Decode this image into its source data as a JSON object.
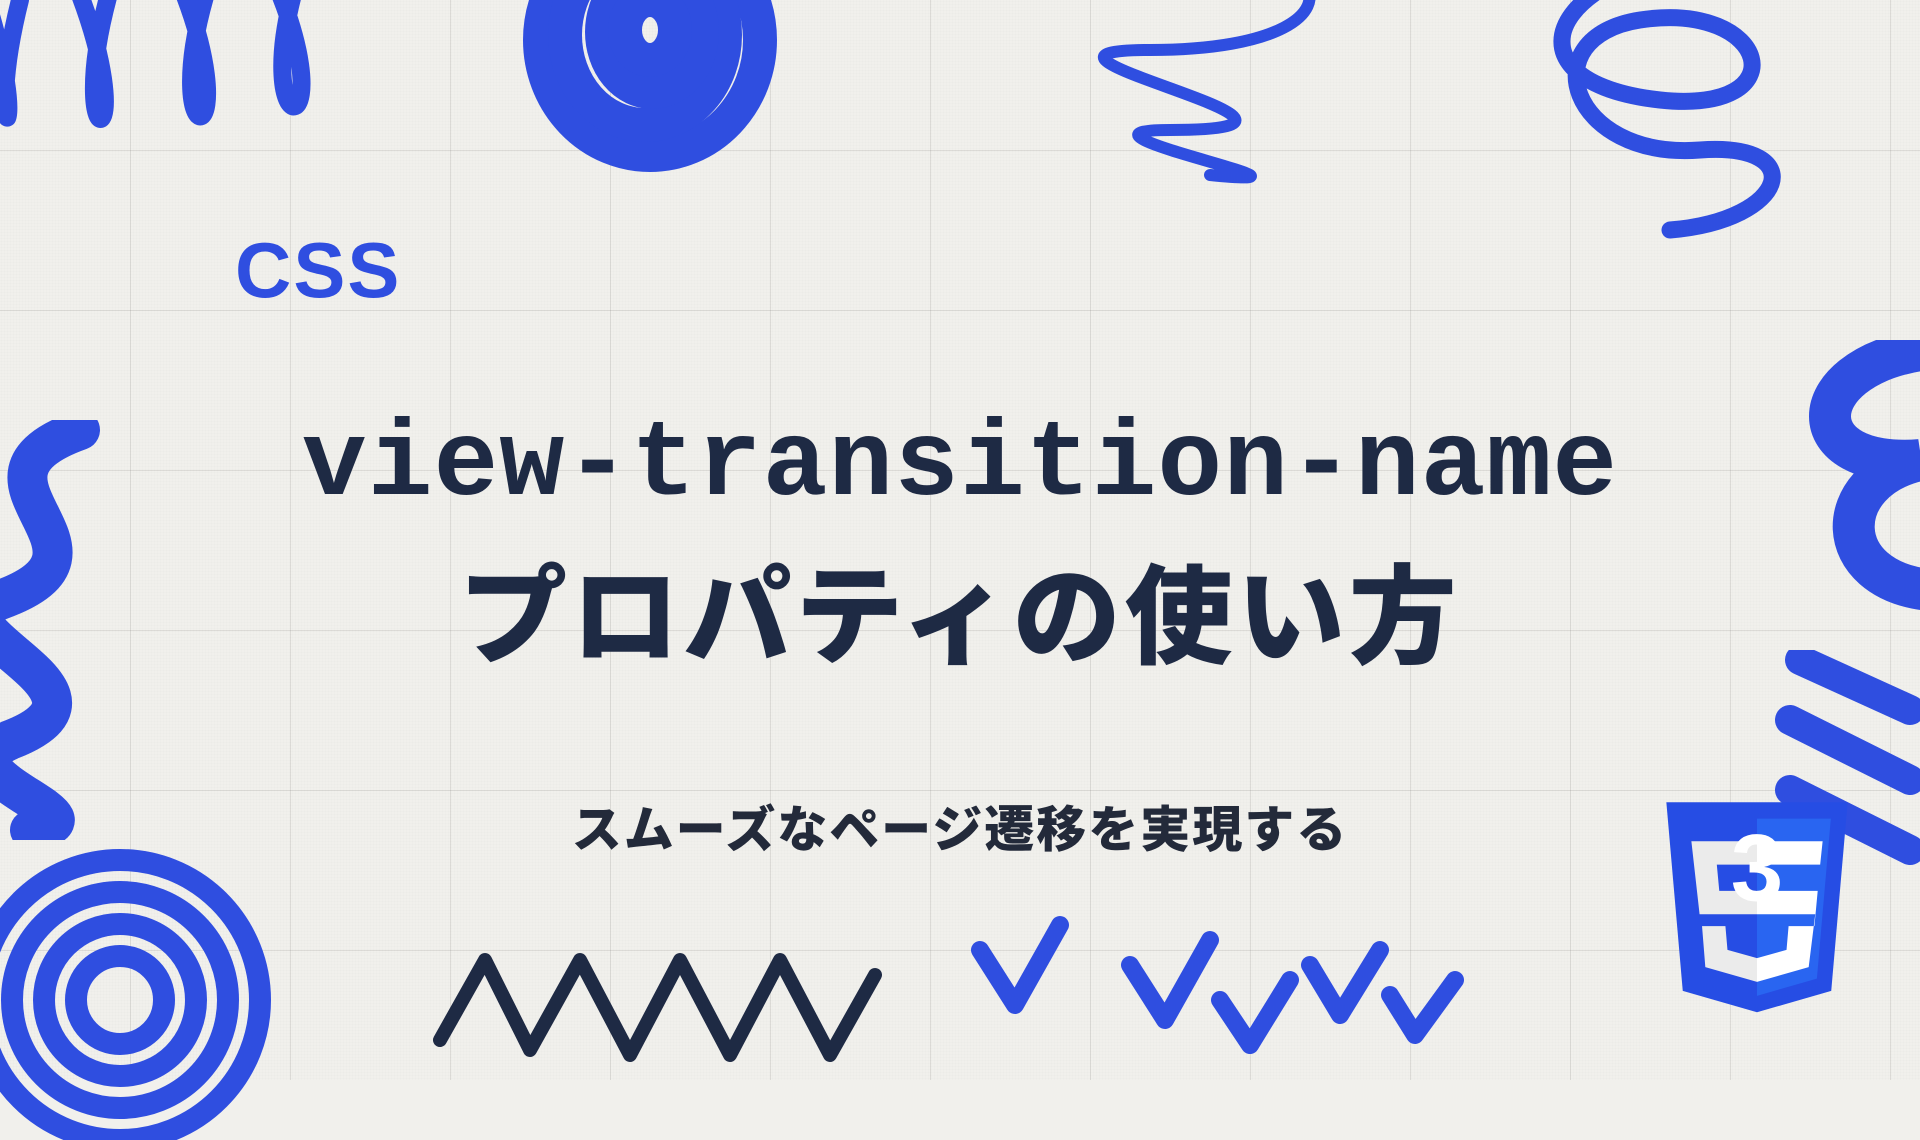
{
  "kicker": "CSS",
  "title_line1": "view-transition-name",
  "title_line2": "プロパティの使い方",
  "subtitle": "スムーズなページ遷移を実現する",
  "logo_label": "3",
  "colors": {
    "accent": "#2f4ee0",
    "heading": "#1e2a44",
    "paper": "#f1f0ec"
  }
}
